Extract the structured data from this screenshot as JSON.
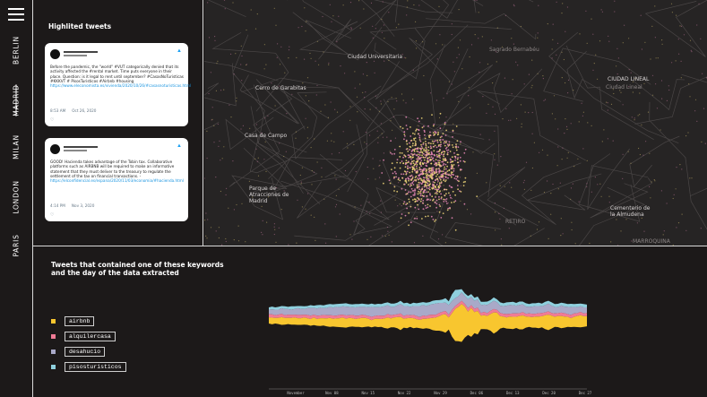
{
  "nav": {
    "menu_icon": "hamburger-icon",
    "cities": [
      {
        "label": "BERLIN",
        "active": false
      },
      {
        "label": "MADRID",
        "active": true
      },
      {
        "label": "MILAN",
        "active": false
      },
      {
        "label": "LONDON",
        "active": false
      },
      {
        "label": "PARIS",
        "active": false
      }
    ]
  },
  "tweets_panel": {
    "title": "Highlited tweets",
    "tweets": [
      {
        "text": "Before the pandemic, the \"world\" #VUT categorically denied that its activity affected the #rental market. Time puts everyone in their place. Question: is it legal to rent until september? #CasasNoTuristicas #KKKVT # PisosTuristicos #Airbnb #housing",
        "link": "https://www.eleconomista.es/vivienda/2020/10/26/#casasnoturisticas.html",
        "time": "8:53 AM",
        "date": "Oct 26, 2020",
        "icon": "twitter-bird-icon",
        "like_icon": "heart-icon"
      },
      {
        "text": "GOOD! Hacienda takes advantage of the Tobin tax. Collaborative platforms such as AIRBNB will be required to make an informative statement that they must deliver to the treasury to regulate the settlement of the tax on financial transactions. -",
        "link": "https://elconfidencial.es/espana/2020/11/03/economia/#hacienda.html",
        "time": "4:14 PM",
        "date": "Nov 3, 2020",
        "icon": "twitter-bird-icon",
        "like_icon": "heart-icon"
      }
    ]
  },
  "map": {
    "labels": [
      "Ciudad Universitaria",
      "Cerro de Garabitas",
      "Casa de Campo",
      "Parque de Atracciones de Madrid",
      "CIUDAD LINEAL",
      "Cementerio de la Almudena",
      "RETIRO",
      "MARROQUINA",
      "Sagrado Bernabéu",
      "Ciudad Lineal"
    ],
    "colors": {
      "background": "#262424",
      "roads": "#4a4646",
      "points_yellow": "#f3d97a",
      "points_pink": "#e98ab8"
    }
  },
  "stream_section": {
    "title": "Tweets that contained one of these keywords and the day of the data extracted",
    "legend": [
      {
        "keyword": "airbnb",
        "color": "#f8c62f"
      },
      {
        "keyword": "alquilercasa",
        "color": "#f07b95"
      },
      {
        "keyword": "desahucio",
        "color": "#a9a9c8"
      },
      {
        "keyword": "pisosturisticos",
        "color": "#8fd0de"
      }
    ]
  },
  "chart_data": {
    "type": "area",
    "title": "Tweets that contained one of these keywords and the day of the data extracted",
    "x_tick_labels": [
      "November",
      "Nov 08",
      "Nov 15",
      "Nov 22",
      "Nov 29",
      "Dec 06",
      "Dec 13",
      "Dec 20",
      "Dec 27"
    ],
    "series": [
      {
        "name": "airbnb",
        "values": [
          11,
          12,
          10,
          11,
          14,
          12,
          11,
          12,
          13,
          12,
          12,
          13,
          12,
          12,
          14,
          12,
          14,
          13,
          14,
          16,
          14,
          15,
          16,
          18,
          16,
          16,
          15,
          14,
          15,
          17,
          16,
          14,
          13,
          14,
          15,
          14,
          17,
          20,
          16,
          18,
          20,
          24,
          16,
          18,
          16,
          18,
          15,
          15,
          18,
          17,
          19,
          22,
          24,
          26,
          30,
          33,
          22,
          42,
          58,
          62,
          68,
          56,
          42,
          52,
          38,
          42,
          24,
          25,
          24,
          30,
          38,
          34,
          22,
          20,
          20,
          22,
          22,
          20,
          24,
          25,
          20,
          18,
          19,
          20,
          21,
          20,
          25,
          28,
          23,
          18,
          20,
          22,
          20,
          18,
          16,
          18,
          20,
          22,
          19,
          18
        ]
      },
      {
        "name": "alquilercasa",
        "values": [
          6,
          6,
          5,
          6,
          6,
          5,
          6,
          6,
          5,
          6,
          6,
          5,
          6,
          6,
          5,
          6,
          5,
          6,
          6,
          5,
          6,
          5,
          6,
          5,
          6,
          5,
          6,
          6,
          5,
          6,
          5,
          5,
          6,
          5,
          6,
          6,
          5,
          6,
          6,
          5,
          5,
          6,
          5,
          6,
          5,
          6,
          6,
          5,
          6,
          5,
          6,
          6,
          5,
          6,
          5,
          6,
          5,
          6,
          5,
          6,
          6,
          5,
          6,
          5,
          6,
          6,
          5,
          6,
          5,
          6,
          6,
          5,
          6,
          5,
          6,
          5,
          6,
          6,
          5,
          6,
          5,
          6,
          6,
          5,
          6,
          6,
          5,
          6,
          5,
          6,
          5,
          6,
          6,
          5,
          6,
          6,
          5,
          6,
          5,
          6
        ]
      },
      {
        "name": "desahucio",
        "values": [
          8,
          9,
          10,
          9,
          10,
          11,
          10,
          9,
          10,
          12,
          11,
          10,
          12,
          14,
          12,
          13,
          14,
          12,
          13,
          15,
          14,
          16,
          14,
          15,
          16,
          15,
          14,
          15,
          16,
          14,
          15,
          16,
          18,
          16,
          15,
          16,
          17,
          16,
          15,
          14,
          16,
          17,
          18,
          16,
          15,
          16,
          18,
          20,
          19,
          18,
          18,
          19,
          20,
          18,
          16,
          15,
          17,
          16,
          14,
          13,
          15,
          14,
          16,
          15,
          14,
          15,
          14,
          13,
          15,
          14,
          15,
          14,
          13,
          14,
          15,
          16,
          15,
          14,
          15,
          14,
          13,
          12,
          13,
          14,
          13,
          12,
          13,
          14,
          13,
          12,
          11,
          13,
          12,
          13,
          14,
          12,
          11,
          10,
          11,
          10
        ]
      },
      {
        "name": "pisosturisticos",
        "values": [
          4,
          5,
          4,
          5,
          4,
          5,
          4,
          6,
          5,
          4,
          5,
          5,
          4,
          5,
          4,
          6,
          5,
          5,
          6,
          5,
          6,
          5,
          6,
          5,
          6,
          5,
          5,
          6,
          5,
          6,
          5,
          5,
          6,
          5,
          6,
          5,
          6,
          5,
          6,
          6,
          5,
          6,
          5,
          6,
          5,
          6,
          5,
          6,
          5,
          6,
          5,
          6,
          6,
          5,
          6,
          8,
          7,
          12,
          15,
          12,
          6,
          5,
          6,
          5,
          6,
          5,
          6,
          5,
          6,
          5,
          6,
          5,
          6,
          5,
          6,
          5,
          6,
          5,
          6,
          5,
          6,
          5,
          6,
          5,
          6,
          5,
          6,
          5,
          6,
          5,
          6,
          5,
          6,
          5,
          6,
          5,
          6,
          5,
          6,
          5
        ]
      }
    ],
    "grid": false,
    "legend_position": "left"
  }
}
